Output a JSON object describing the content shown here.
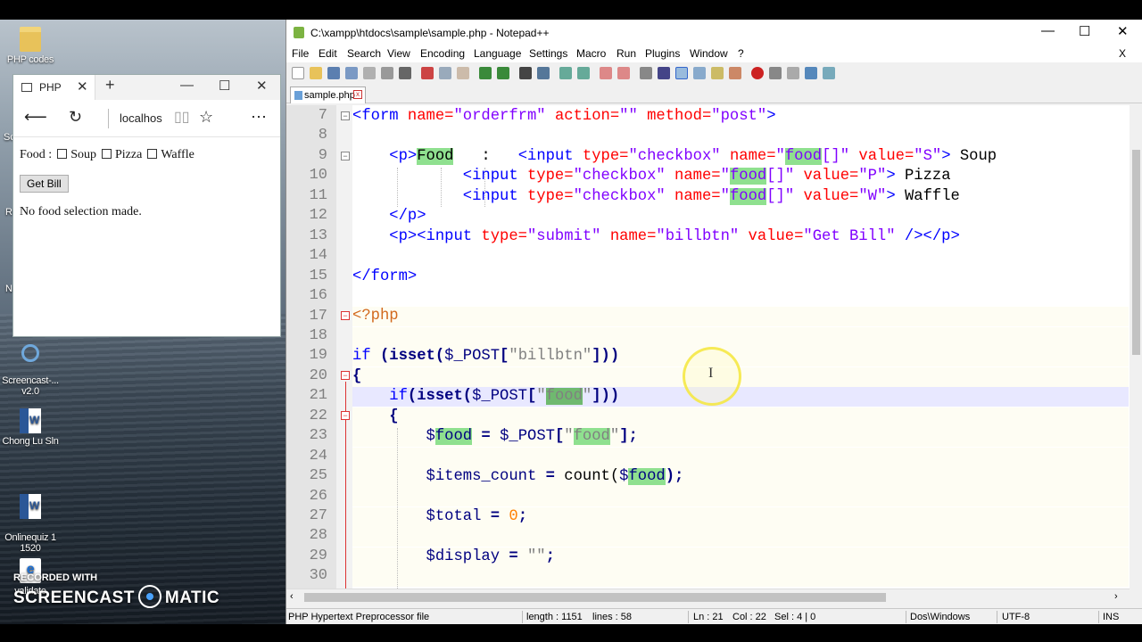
{
  "desktop": {
    "icons": [
      {
        "label": "PHP codes"
      },
      {
        "label": "Screencast-...\nv2.0"
      },
      {
        "label": "Chong Lu Sln"
      },
      {
        "label": "Onlinequiz 1\n1520"
      },
      {
        "label": "validate"
      }
    ],
    "edge_fragments": [
      "Sc",
      "Re",
      "N"
    ]
  },
  "browser": {
    "tab_title": "PHP",
    "address": "localhos",
    "form": {
      "food_label": "Food :",
      "options": [
        "Soup",
        "Pizza",
        "Waffle"
      ],
      "submit_label": "Get Bill",
      "message": "No food selection made."
    }
  },
  "watermark": {
    "line1": "RECORDED WITH",
    "left": "SCREENCAST",
    "right": "MATIC"
  },
  "npp": {
    "title": "C:\\xampp\\htdocs\\sample\\sample.php - Notepad++",
    "menu": [
      "File",
      "Edit",
      "Search",
      "View",
      "Encoding",
      "Language",
      "Settings",
      "Macro",
      "Run",
      "Plugins",
      "Window",
      "?"
    ],
    "close_x": "X",
    "tab": "sample.php",
    "line_numbers": [
      "7",
      "8",
      "9",
      "10",
      "11",
      "12",
      "13",
      "14",
      "15",
      "16",
      "17",
      "18",
      "19",
      "20",
      "21",
      "22",
      "23",
      "24",
      "25",
      "26",
      "27",
      "28",
      "29",
      "30"
    ],
    "status": {
      "file_type": "PHP Hypertext Preprocessor file",
      "length": "length : 1151",
      "lines": "lines : 58",
      "ln": "Ln : 21",
      "col": "Col : 22",
      "sel": "Sel : 4 | 0",
      "eol": "Dos\\Windows",
      "encoding": "UTF-8",
      "mode": "INS"
    }
  },
  "code": {
    "l7": {
      "open": "<form",
      "a1": " name=",
      "v1": "\"orderfrm\"",
      "a2": " action=",
      "v2": "\"\"",
      "a3": " method=",
      "v3": "\"post\"",
      "close": ">"
    },
    "l9": {
      "p": "<p>",
      "food": "Food",
      "colon": "   :   ",
      "input": "<input",
      "a1": " type=",
      "v1": "\"checkbox\"",
      "a2": " name=",
      "v2a": "\"",
      "v2b": "food",
      "v2c": "[]\"",
      "a3": " value=",
      "v3": "\"S\"",
      "close": ">",
      "text": " Soup"
    },
    "l10": {
      "input": "<input",
      "a1": " type=",
      "v1": "\"checkbox\"",
      "a2": " name=",
      "v2a": "\"",
      "v2b": "food",
      "v2c": "[]\"",
      "a3": " value=",
      "v3": "\"P\"",
      "close": ">",
      "text": " Pizza"
    },
    "l11": {
      "input": "<input",
      "a1": " type=",
      "v1": "\"checkbox\"",
      "a2": " name=",
      "v2a": "\"",
      "v2b": "food",
      "v2c": "[]\"",
      "a3": " value=",
      "v3": "\"W\"",
      "close": ">",
      "text": " Waffle"
    },
    "l12": {
      "tag": "</p>"
    },
    "l13": {
      "p": "<p><input",
      "a1": " type=",
      "v1": "\"submit\"",
      "a2": " name=",
      "v2": "\"billbtn\"",
      "a3": " value=",
      "v3": "\"Get Bill\"",
      "close": " /></p>"
    },
    "l15": {
      "tag": "</form>"
    },
    "l17": {
      "tag": "<?php"
    },
    "l19": {
      "kw": "if",
      "p1": " (isset(",
      "var": "$_POST",
      "p2": "[",
      "str": "\"billbtn\"",
      "p3": "]))"
    },
    "l20": {
      "brace": "{"
    },
    "l21": {
      "kw": "if",
      "p1": "(isset(",
      "var": "$_POST",
      "p2": "[",
      "q1": "\"",
      "str": "food",
      "q2": "\"",
      "p3": "]))"
    },
    "l22": {
      "brace": "{"
    },
    "l23": {
      "var1a": "$",
      "var1b": "food",
      "eq": " = ",
      "var2": "$_POST",
      "p1": "[",
      "q1": "\"",
      "str": "food",
      "q2": "\"",
      "p2": "];"
    },
    "l25": {
      "var1": "$items_count",
      "eq": " = ",
      "fn": "count(",
      "var2a": "$",
      "var2b": "food",
      "p": ");"
    },
    "l27": {
      "var": "$total",
      "eq": " = ",
      "num": "0",
      "semi": ";"
    },
    "l29": {
      "var": "$display",
      "eq": " = ",
      "str": "\"\"",
      "semi": ";"
    }
  }
}
